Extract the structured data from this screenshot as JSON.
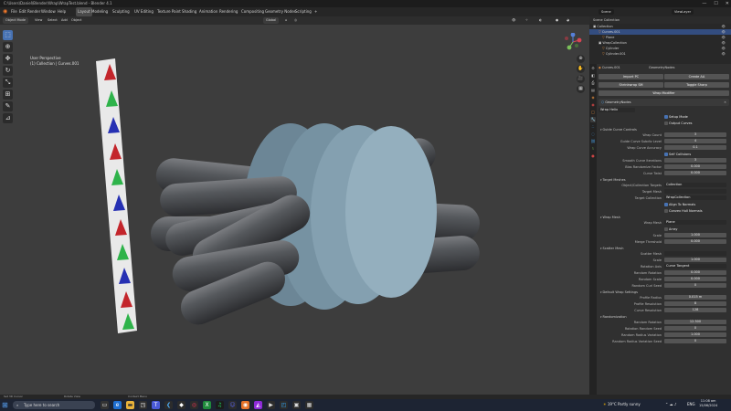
{
  "titlebar": {
    "title": "C:\\Users\\Daniel\\Blender\\Wrap\\WrapTest.blend - Blender 4.1"
  },
  "menubar": {
    "editor_type_icon": "blender-icon",
    "menus": [
      "File",
      "Edit",
      "Render",
      "Window",
      "Help"
    ],
    "workspaces": [
      "Layout",
      "Modeling",
      "Sculpting",
      "UV Editing",
      "Texture Paint",
      "Shading",
      "Animation",
      "Rendering",
      "Compositing",
      "Geometry Nodes",
      "Scripting"
    ],
    "active_workspace": "Layout",
    "scene": "Scene",
    "view_layer": "ViewLayer"
  },
  "viewport_header": {
    "mode": "Object Mode",
    "menus": [
      "View",
      "Select",
      "Add",
      "Object"
    ],
    "orientation": "Global"
  },
  "viewport": {
    "perspective": "User Perspective",
    "collection_path": "(1) Collection | Curves.001",
    "left_ribbon_arrows": [
      {
        "color": "#c3252b"
      },
      {
        "color": "#2eb34a"
      },
      {
        "color": "#2630b3"
      },
      {
        "color": "#c3252b"
      },
      {
        "color": "#2eb34a"
      },
      {
        "color": "#2630b3"
      },
      {
        "color": "#c3252b"
      },
      {
        "color": "#2eb34a"
      },
      {
        "color": "#2630b3"
      },
      {
        "color": "#c3252b"
      },
      {
        "color": "#2eb34a"
      }
    ]
  },
  "toolbar": {
    "tools": [
      {
        "name": "select-box-icon",
        "glyph": "⬚"
      },
      {
        "name": "cursor-icon",
        "glyph": "⊕"
      },
      {
        "name": "move-icon",
        "glyph": "✥"
      },
      {
        "name": "rotate-icon",
        "glyph": "↻"
      },
      {
        "name": "scale-icon",
        "glyph": "⤡"
      },
      {
        "name": "transform-icon",
        "glyph": "⊞"
      },
      {
        "name": "annotate-icon",
        "glyph": "✎"
      },
      {
        "name": "measure-icon",
        "glyph": "📏"
      }
    ]
  },
  "outliner": {
    "title": "Scene Collection",
    "rows": [
      {
        "label": "Collection",
        "indent": 4,
        "selected": false
      },
      {
        "label": "Curves.001",
        "indent": 10,
        "selected": true
      },
      {
        "label": "Plane",
        "indent": 14,
        "selected": false
      },
      {
        "label": "WrapCollection",
        "indent": 10,
        "selected": false
      },
      {
        "label": "Cylinder",
        "indent": 14,
        "selected": false
      },
      {
        "label": "Cylinder.001",
        "indent": 14,
        "selected": false
      }
    ]
  },
  "properties": {
    "object_name": "Curves.001",
    "modifier_type": "GeometryNodes",
    "top_buttons": [
      "Import PC",
      "Shrinkwrap SM",
      "Create AA",
      "Toggle Sharp"
    ],
    "apply_label": "Wrap Modifier",
    "node_group": "GeometryNodes",
    "setup_label": "Wrap Helix",
    "setup_checks": [
      {
        "label": "Setup Mode",
        "on": true
      },
      {
        "label": "Output Curves",
        "on": false
      }
    ],
    "sections": [
      {
        "title": "Guide Curve Controls",
        "rows": [
          {
            "label": "Wrap Count",
            "value": "3"
          },
          {
            "label": "Guide Curve Subdiv Level",
            "value": "4"
          },
          {
            "label": "Wrap Curve Accuracy",
            "value": "0.1"
          },
          {
            "check": "Self Collisions",
            "on": true
          },
          {
            "label": "Smooth Curve Iterations",
            "value": "3"
          },
          {
            "label": "Bias Randomize Factor",
            "value": "0.000"
          },
          {
            "label": "Curve Twist",
            "value": "0.000"
          }
        ]
      },
      {
        "title": "Target Meshes",
        "rows": [
          {
            "label": "Object/Collection Targets",
            "value": "Collection",
            "dropdown": true
          },
          {
            "label": "Target Mesh",
            "value": "",
            "dropdown": true
          },
          {
            "label": "Target Collection",
            "value": "WrapCollection",
            "dropdown": true
          },
          {
            "check": "Align To Normals",
            "on": true
          },
          {
            "check": "Convex Hull Normals",
            "on": false
          }
        ]
      },
      {
        "title": "Wrap Mesh",
        "rows": [
          {
            "label": "Wrap Mesh",
            "value": "Plane",
            "dropdown": true
          },
          {
            "check": "Array",
            "on": false
          },
          {
            "label": "Scale",
            "value": "1.000"
          },
          {
            "label": "Merge Threshold",
            "value": "0.000"
          }
        ]
      },
      {
        "title": "Scatter Mesh",
        "rows": [
          {
            "label": "Scatter Mesh",
            "value": "",
            "dropdown": true
          },
          {
            "label": "Scale",
            "value": "1.000"
          },
          {
            "label": "Rotation Axis",
            "value": "Curve Tangent",
            "dropdown": true
          },
          {
            "label": "Random Rotation",
            "value": "0.000"
          },
          {
            "label": "Random Scale",
            "value": "0.000"
          },
          {
            "label": "Random Curl Seed",
            "value": "0"
          }
        ]
      },
      {
        "title": "Default Wrap Settings",
        "rows": [
          {
            "label": "Profile Radius",
            "value": "0.015 m"
          },
          {
            "label": "Profile Resolution",
            "value": "8"
          },
          {
            "label": "Curve Resolution",
            "value": "128"
          }
        ]
      },
      {
        "title": "Randomization",
        "rows": [
          {
            "label": "Random Rotation",
            "value": "12.500"
          },
          {
            "label": "Rotation Random Seed",
            "value": "0"
          },
          {
            "label": "Random Radius Variation",
            "value": "1.000"
          },
          {
            "label": "Random Radius Variation Seed",
            "value": "0"
          }
        ]
      }
    ]
  },
  "statusbar": {
    "left": "Set 3D Cursor",
    "middle": "Rotate View",
    "right": "Context Menu"
  },
  "taskbar": {
    "search_placeholder": "Type here to search",
    "weather": "19°C  Partly sunny",
    "lang": "ENG",
    "time": "11:08 am",
    "date": "15/06/2024"
  }
}
